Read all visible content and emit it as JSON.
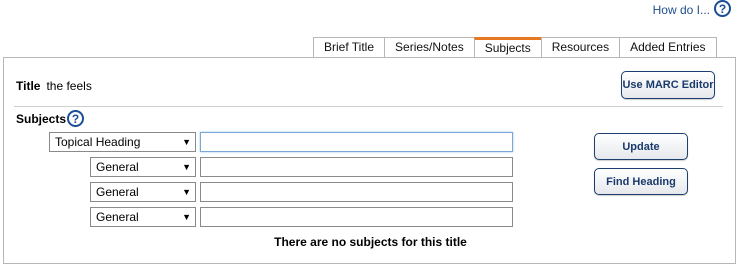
{
  "help": {
    "label": "How do I...",
    "icon": "?"
  },
  "tabs": [
    {
      "label": "Brief Title",
      "active": false
    },
    {
      "label": "Series/Notes",
      "active": false
    },
    {
      "label": "Subjects",
      "active": true
    },
    {
      "label": "Resources",
      "active": false
    },
    {
      "label": "Added Entries",
      "active": false
    }
  ],
  "record": {
    "title_label": "Title",
    "title_value": "the feels"
  },
  "buttons": {
    "marc_editor": "Use MARC Editor",
    "update": "Update",
    "find_heading": "Find Heading"
  },
  "subjects": {
    "label": "Subjects",
    "help_icon": "?",
    "rows": [
      {
        "type": "Topical Heading",
        "value": ""
      },
      {
        "type": "General",
        "value": ""
      },
      {
        "type": "General",
        "value": ""
      },
      {
        "type": "General",
        "value": ""
      }
    ],
    "empty_message": "There are no subjects for this title"
  },
  "colors": {
    "accent": "#e87722",
    "link": "#1f4e8c",
    "button_border": "#1b3f6f"
  }
}
